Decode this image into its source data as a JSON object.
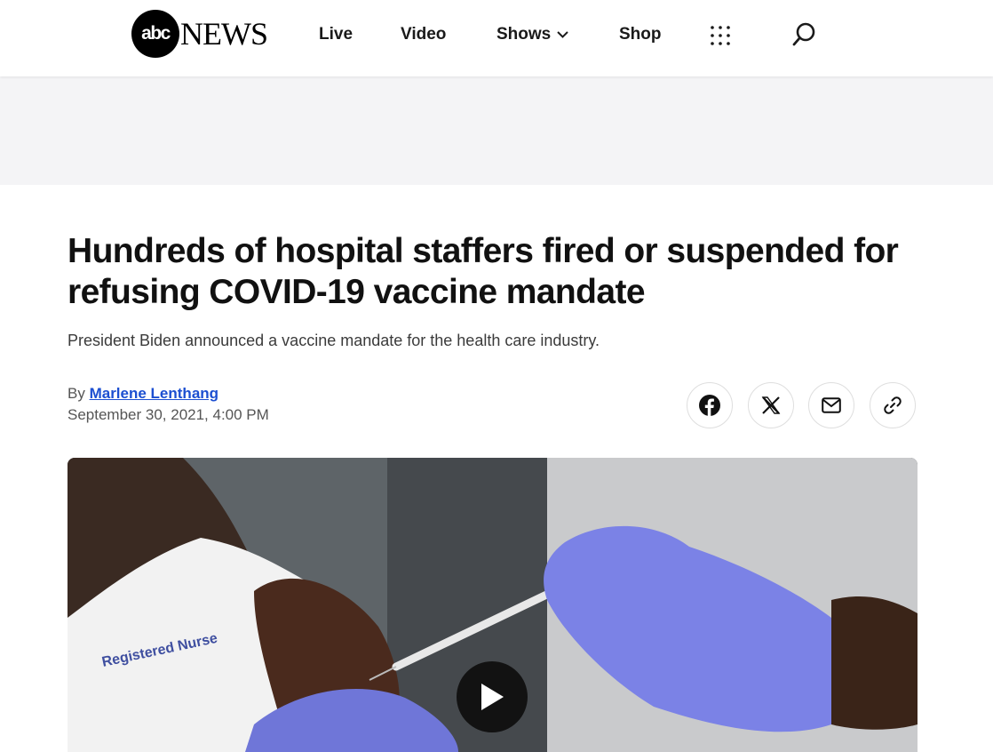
{
  "brand": {
    "logo_mark": "abc",
    "logo_word": "NEWS"
  },
  "nav": {
    "items": [
      {
        "label": "Live"
      },
      {
        "label": "Video"
      },
      {
        "label": "Shows"
      },
      {
        "label": "Shop"
      }
    ],
    "grid_icon": "apps-grid-icon",
    "search_icon": "search-icon"
  },
  "article": {
    "headline": "Hundreds of hospital staffers fired or suspended for refusing COVID-19 vaccine mandate",
    "dek": "President Biden announced a vaccine mandate for the health care industry.",
    "by_prefix": "By",
    "author": "Marlene Lenthang",
    "date": "September 30, 2021, 4:00 PM"
  },
  "share": {
    "icons": [
      "facebook-icon",
      "x-icon",
      "mail-icon",
      "link-icon"
    ]
  },
  "hero": {
    "gown_text": "Registered Nurse",
    "play_icon": "play-icon"
  },
  "colors": {
    "link": "#1c4fd1",
    "ad_band": "#f4f4f6",
    "glove": "#7b82e6"
  }
}
